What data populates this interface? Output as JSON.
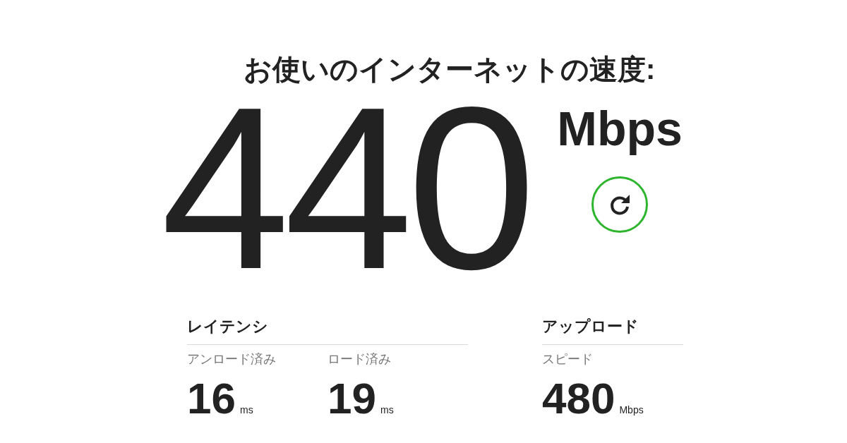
{
  "title": "お使いのインターネットの速度:",
  "speed": {
    "value": "440",
    "unit": "Mbps"
  },
  "sections": [
    {
      "heading": "レイテンシ",
      "metrics": [
        {
          "label": "アンロード済み",
          "value": "16",
          "unit": "ms"
        },
        {
          "label": "ロード済み",
          "value": "19",
          "unit": "ms"
        }
      ]
    },
    {
      "heading": "アップロード",
      "metrics": [
        {
          "label": "スピード",
          "value": "480",
          "unit": "Mbps"
        }
      ]
    }
  ]
}
